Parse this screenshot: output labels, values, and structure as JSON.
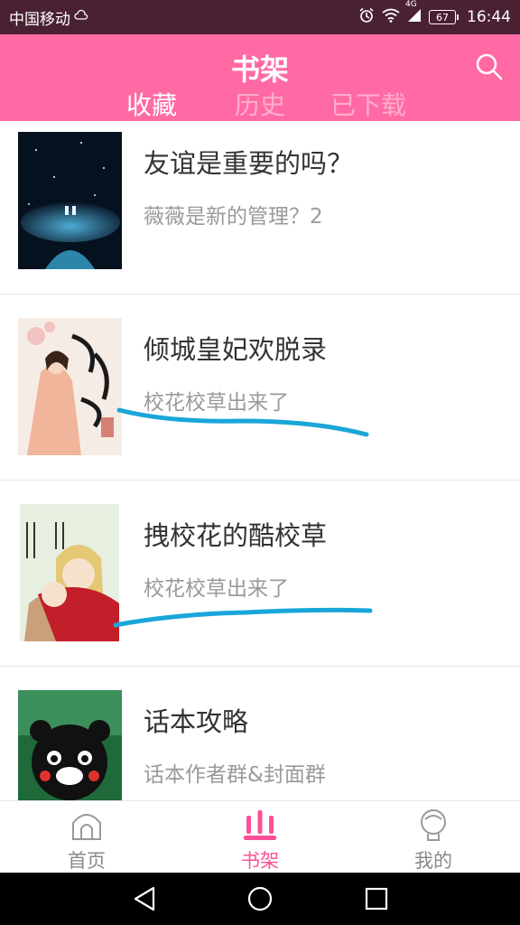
{
  "status_bar": {
    "carrier": "中国移动",
    "network": "4G",
    "battery": "67",
    "time": "16:44"
  },
  "header": {
    "title": "书架",
    "tabs": [
      {
        "label": "收藏",
        "active": true
      },
      {
        "label": "历史",
        "active": false
      },
      {
        "label": "已下载",
        "active": false
      }
    ]
  },
  "books": [
    {
      "title": "友谊是重要的吗？",
      "subtitle": "薇薇是新的管理？2",
      "cover": "starry-night-cover"
    },
    {
      "title": "倾城皇妃欢脱录",
      "subtitle": "校花校草出来了",
      "cover": "ancient-princess-cover"
    },
    {
      "title": "拽校花的酷校草",
      "subtitle": "校花校草出来了",
      "cover": "anime-couple-cover"
    },
    {
      "title": "话本攻略",
      "subtitle": "话本作者群&封面群",
      "cover": "kumamon-cover"
    }
  ],
  "bottom_nav": [
    {
      "label": "首页",
      "icon": "home-icon",
      "active": false
    },
    {
      "label": "书架",
      "icon": "bookshelf-icon",
      "active": true
    },
    {
      "label": "我的",
      "icon": "profile-icon",
      "active": false
    }
  ],
  "colors": {
    "status_bar": "#4a2133",
    "header": "#ff6aa4",
    "active_nav": "#ff4f97",
    "annotation": "#1aa6d8"
  }
}
